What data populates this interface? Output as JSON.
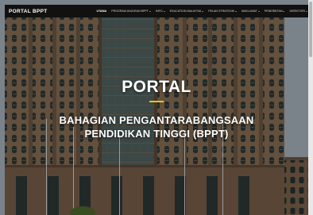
{
  "navbar": {
    "brand": "PORTAL BPPT",
    "menu": [
      {
        "label": "UTAMA",
        "dropdown": false,
        "active": true
      },
      {
        "label": "PROGRAM ANJURAN BPPT",
        "dropdown": true,
        "active": false
      },
      {
        "label": "INFO",
        "dropdown": true,
        "active": false
      },
      {
        "label": "EDUCATION MALAYSIA",
        "dropdown": true,
        "active": false
      },
      {
        "label": "PELAN STRATEGIK",
        "dropdown": true,
        "active": false
      },
      {
        "label": "MAKLUMAT",
        "dropdown": true,
        "active": false
      },
      {
        "label": "PENERBITAN",
        "dropdown": true,
        "active": false
      },
      {
        "label": "DIREKTORI",
        "dropdown": true,
        "active": false
      }
    ]
  },
  "hero": {
    "title": "PORTAL",
    "subtitle_line1": "BAHAGIAN PENGANTARABANGSAAN",
    "subtitle_line2": "PENDIDIKAN TINGGI (BPPT)"
  },
  "colors": {
    "navbar_bg": "#111111",
    "accent_underline": "#f1c40f",
    "text": "#ffffff"
  }
}
